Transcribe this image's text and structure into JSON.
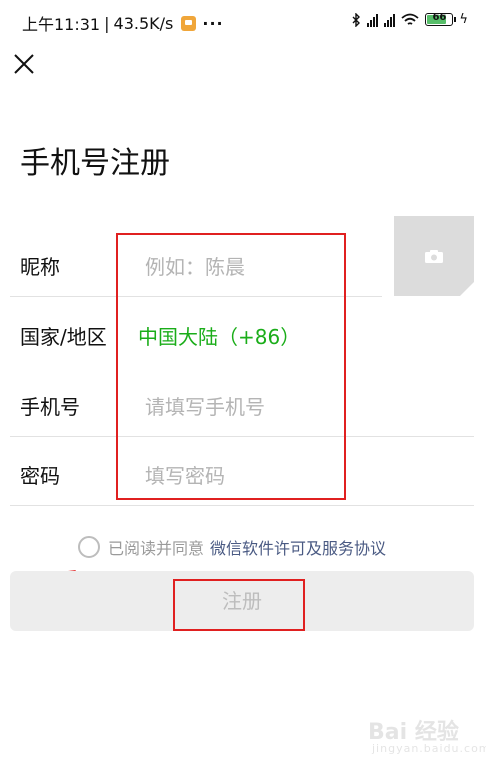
{
  "status_bar": {
    "time": "上午11:31",
    "speed": "43.5K/s",
    "more": "···",
    "battery": "66"
  },
  "header": {
    "title": "手机号注册"
  },
  "form": {
    "nickname_label": "昵称",
    "nickname_placeholder": "例如：陈晨",
    "region_label": "国家/地区",
    "region_value": "中国大陆（+86）",
    "phone_label": "手机号",
    "phone_placeholder": "请填写手机号",
    "password_label": "密码",
    "password_placeholder": "填写密码"
  },
  "agreement": {
    "text": "已阅读并同意",
    "link": "微信软件许可及服务协议"
  },
  "register_button": {
    "label": "注册"
  },
  "watermark": {
    "text": "Bai 经验",
    "url": "jingyan.baidu.com"
  },
  "colors": {
    "accent_green": "#1aad19",
    "link_blue": "#4a5a83",
    "annotation_red": "#e02020"
  }
}
